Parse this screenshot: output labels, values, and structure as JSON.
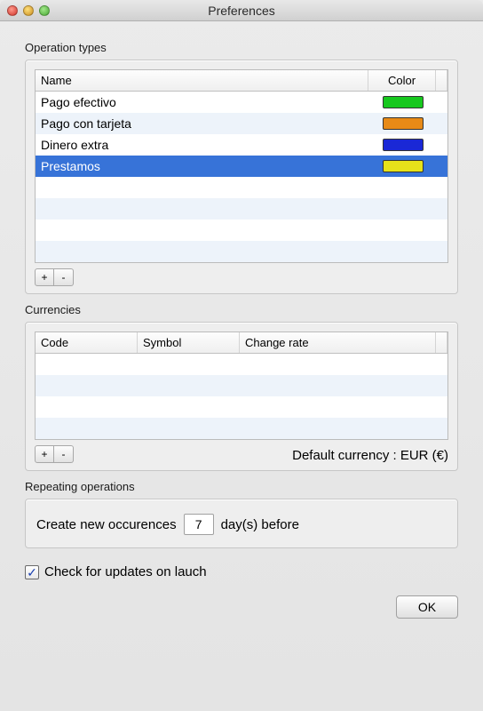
{
  "window": {
    "title": "Preferences"
  },
  "operation_types": {
    "label": "Operation types",
    "columns": {
      "name": "Name",
      "color": "Color"
    },
    "rows": [
      {
        "name": "Pago efectivo",
        "color": "#17c81e",
        "selected": false
      },
      {
        "name": "Pago con tarjeta",
        "color": "#e88a16",
        "selected": false
      },
      {
        "name": "Dinero extra",
        "color": "#1a28d6",
        "selected": false
      },
      {
        "name": "Prestamos",
        "color": "#e6e21a",
        "selected": true
      }
    ],
    "add_label": "+",
    "remove_label": "-"
  },
  "currencies": {
    "label": "Currencies",
    "columns": {
      "code": "Code",
      "symbol": "Symbol",
      "rate": "Change rate"
    },
    "rows": [],
    "add_label": "+",
    "remove_label": "-",
    "default_currency_label": "Default currency : EUR (€)"
  },
  "repeating": {
    "label": "Repeating operations",
    "prefix": "Create new occurences",
    "days_value": "7",
    "suffix": "day(s) before"
  },
  "updates": {
    "checked": true,
    "label": "Check for updates on lauch"
  },
  "ok_label": "OK"
}
